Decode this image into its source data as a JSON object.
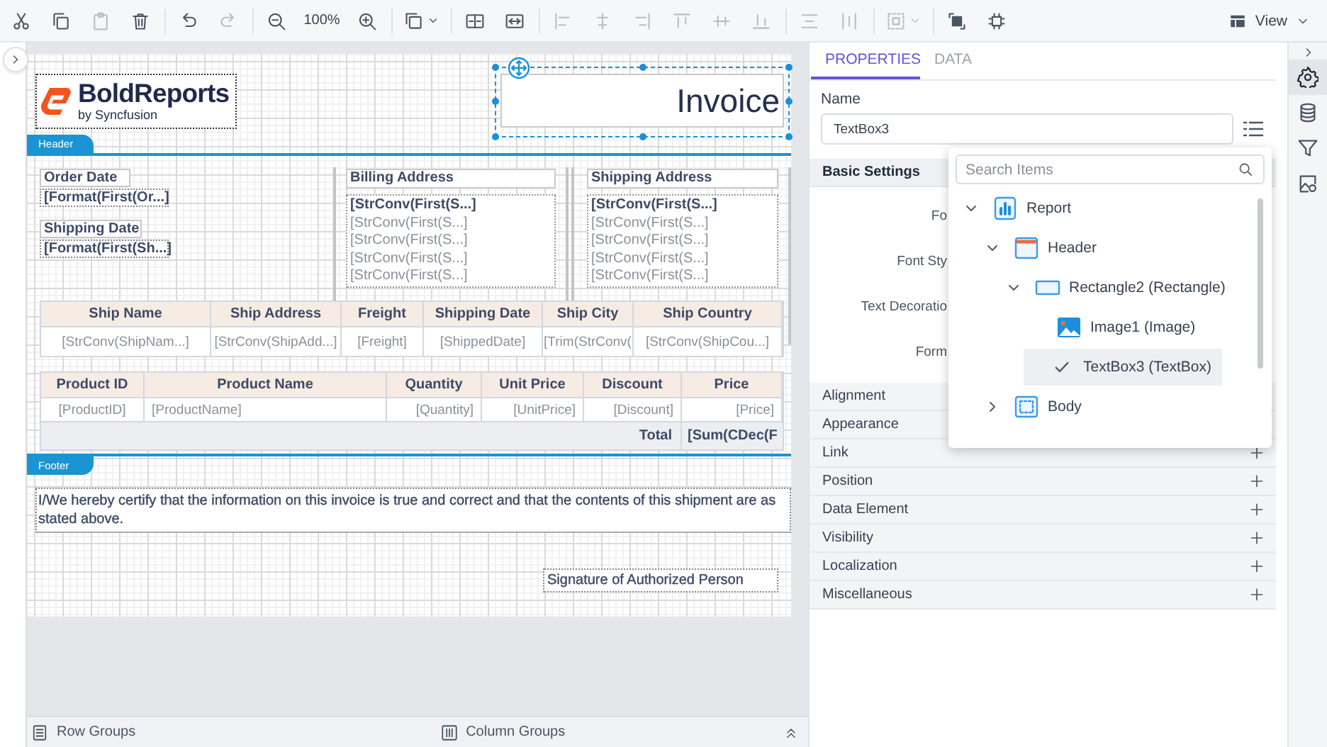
{
  "toolbar": {
    "groups": [
      [
        {
          "kind": "button",
          "disabled": false
        },
        {
          "kind": "button",
          "disabled": false
        },
        {
          "kind": "button",
          "disabled": true
        },
        {
          "kind": "button",
          "disabled": false
        }
      ],
      [
        {
          "kind": "button",
          "disabled": false
        },
        {
          "kind": "button",
          "disabled": true
        }
      ],
      [
        {
          "kind": "button",
          "disabled": false
        },
        {
          "kind": "text",
          "text": "100%"
        },
        {
          "kind": "button",
          "disabled": false
        }
      ],
      [
        {
          "kind": "dropdown",
          "disabled": false
        }
      ],
      [
        {
          "kind": "button",
          "disabled": false
        },
        {
          "kind": "button",
          "disabled": false
        }
      ],
      [
        {
          "kind": "button",
          "disabled": true
        },
        {
          "kind": "button",
          "disabled": true
        },
        {
          "kind": "button",
          "disabled": true
        },
        {
          "kind": "button",
          "disabled": true
        },
        {
          "kind": "button",
          "disabled": true
        },
        {
          "kind": "button",
          "disabled": true
        }
      ],
      [
        {
          "kind": "button",
          "disabled": true
        },
        {
          "kind": "button",
          "disabled": true
        }
      ],
      [
        {
          "kind": "dropdown",
          "disabled": true
        }
      ],
      [
        {
          "kind": "button",
          "disabled": false
        },
        {
          "kind": "button",
          "disabled": false
        }
      ]
    ],
    "view": {
      "label": "View"
    }
  },
  "report": {
    "header_band": {
      "label": "Header"
    },
    "logo": {
      "title": "BoldReports",
      "subtitle": "by Syncfusion"
    },
    "title_box": {
      "text": "Invoice",
      "selected": true
    },
    "order_info": [
      {
        "label": "Order Date",
        "value": "[Format(First(Or...]"
      },
      {
        "label": "Shipping Date",
        "value": "[Format(First(Sh...]"
      }
    ],
    "addresses": [
      {
        "heading": "Billing Address",
        "lines": [
          {
            "text": "[StrConv(First(S...]",
            "bold": true
          },
          {
            "text": "[StrConv(First(S...]",
            "bold": false
          },
          {
            "text": "[StrConv(First(S...]",
            "bold": false
          },
          {
            "text": "[StrConv(First(S...]",
            "bold": false
          },
          {
            "text": "[StrConv(First(S...]",
            "bold": false
          }
        ]
      },
      {
        "heading": "Shipping Address",
        "lines": [
          {
            "text": "[StrConv(First(S...]",
            "bold": true
          },
          {
            "text": "[StrConv(First(S...]",
            "bold": false
          },
          {
            "text": "[StrConv(First(S...]",
            "bold": false
          },
          {
            "text": "[StrConv(First(S...]",
            "bold": false
          },
          {
            "text": "[StrConv(First(S...]",
            "bold": false
          }
        ]
      }
    ],
    "ship_table": {
      "columns": [
        "Ship Name",
        "Ship Address",
        "Freight",
        "Shipping Date",
        "Ship City",
        "Ship Country"
      ],
      "rows": [
        [
          "[StrConv(ShipNam...]",
          "[StrConv(ShipAdd...]",
          "[Freight]",
          "[ShippedDate]",
          "[Trim(StrConv(",
          "[StrConv(ShipCou...]"
        ]
      ]
    },
    "product_table": {
      "columns": [
        "Product ID",
        "Product Name",
        "Quantity",
        "Unit Price",
        "Discount",
        "Price"
      ],
      "rows": [
        [
          "[ProductID]",
          "[ProductName]",
          "[Quantity]",
          "[UnitPrice]",
          "[Discount]",
          "[Price]"
        ]
      ],
      "total": {
        "label": "Total",
        "value": "[Sum(CDec(F"
      }
    },
    "footer_band": {
      "label": "Footer"
    },
    "certification": "I/We hereby certify that the information on this invoice is true and correct and that the contents of this shipment are as stated above.",
    "signature": "Signature of Authorized Person"
  },
  "groups_bar": {
    "row_groups": "Row Groups",
    "column_groups": "Column Groups"
  },
  "properties": {
    "tabs": [
      {
        "label": "PROPERTIES",
        "selected": true
      },
      {
        "label": "DATA",
        "selected": false
      }
    ],
    "name_label": "Name",
    "name_value": "TextBox3",
    "sections": [
      {
        "title": "Basic Settings",
        "expanded": true,
        "fields": [
          "Fo",
          "Font Sty",
          "Text Decoratio",
          "Form"
        ]
      },
      {
        "title": "Alignment"
      },
      {
        "title": "Appearance"
      },
      {
        "title": "Link",
        "expanded": false
      },
      {
        "title": "Position",
        "expanded": false
      },
      {
        "title": "Data Element",
        "expanded": false
      },
      {
        "title": "Visibility",
        "expanded": false
      },
      {
        "title": "Localization",
        "expanded": false
      },
      {
        "title": "Miscellaneous",
        "expanded": false
      }
    ]
  },
  "outline_popup": {
    "search_placeholder": "Search Items",
    "tree": [
      {
        "label": "Report",
        "kind": "report",
        "expanded": true,
        "selected": false,
        "children": [
          {
            "label": "Header",
            "kind": "header",
            "expanded": true,
            "selected": false,
            "children": [
              {
                "label": "Rectangle2 (Rectangle)",
                "kind": "rectangle",
                "expanded": true,
                "selected": false,
                "children": [
                  {
                    "label": "Image1 (Image)",
                    "kind": "image",
                    "selected": false
                  },
                  {
                    "label": "TextBox3 (TextBox)",
                    "kind": "textbox",
                    "selected": true
                  }
                ]
              }
            ]
          },
          {
            "label": "Body",
            "kind": "body",
            "expanded": false,
            "selected": false
          }
        ]
      }
    ]
  },
  "rail": [
    {
      "selected": true
    },
    {
      "selected": false
    },
    {
      "selected": false
    },
    {
      "selected": false
    }
  ]
}
